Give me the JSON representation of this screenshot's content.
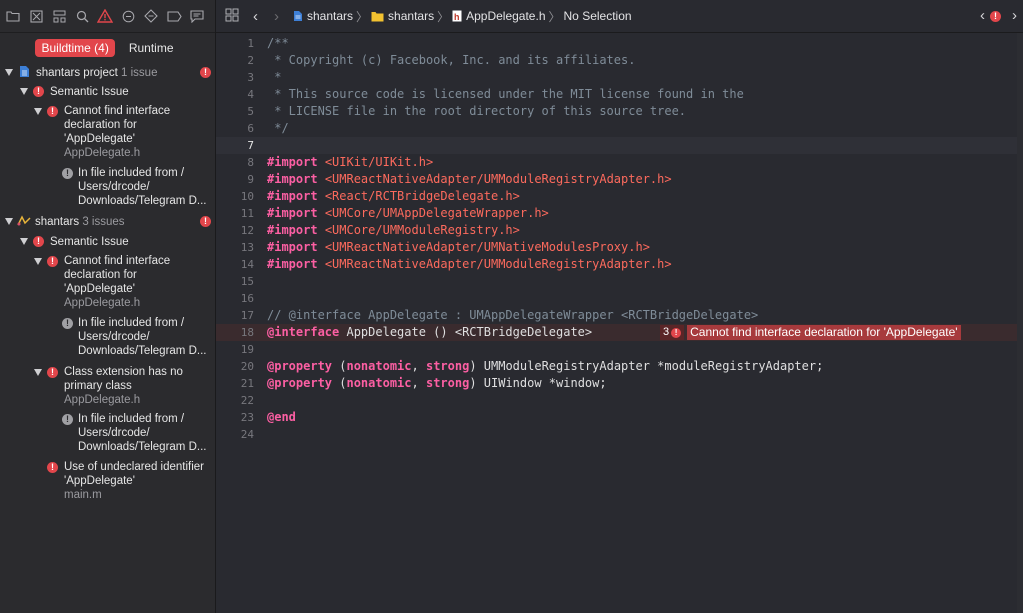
{
  "tabs": {
    "buildtime": "Buildtime (4)",
    "runtime": "Runtime"
  },
  "tree": [
    {
      "kind": "project",
      "label": "shantars project",
      "count": "1 issue"
    },
    {
      "kind": "category",
      "label": "Semantic Issue"
    },
    {
      "kind": "error",
      "lines": [
        "Cannot find interface",
        "declaration for",
        "'AppDelegate'"
      ],
      "file": "AppDelegate.h"
    },
    {
      "kind": "info",
      "lines": [
        "In file included from /",
        "Users/drcode/",
        "Downloads/Telegram D..."
      ]
    },
    {
      "kind": "target",
      "label": "shantars",
      "count": "3 issues"
    },
    {
      "kind": "category",
      "label": "Semantic Issue"
    },
    {
      "kind": "error",
      "lines": [
        "Cannot find interface",
        "declaration for",
        "'AppDelegate'"
      ],
      "file": "AppDelegate.h"
    },
    {
      "kind": "info",
      "lines": [
        "In file included from /",
        "Users/drcode/",
        "Downloads/Telegram D..."
      ]
    },
    {
      "kind": "error",
      "lines": [
        "Class extension has no",
        "primary class"
      ],
      "file": "AppDelegate.h"
    },
    {
      "kind": "info",
      "lines": [
        "In file included from /",
        "Users/drcode/",
        "Downloads/Telegram D..."
      ]
    },
    {
      "kind": "error",
      "lines": [
        "Use of undeclared identifier",
        "'AppDelegate'"
      ],
      "file": "main.m"
    }
  ],
  "jumpbar": {
    "project": "shantars",
    "folder": "shantars",
    "file": "AppDelegate.h",
    "symbol": "No Selection"
  },
  "code": {
    "lines": [
      {
        "n": "1",
        "tokens": [
          [
            "comment",
            "/**"
          ]
        ]
      },
      {
        "n": "2",
        "tokens": [
          [
            "comment",
            " * Copyright (c) Facebook, Inc. and its affiliates."
          ]
        ]
      },
      {
        "n": "3",
        "tokens": [
          [
            "comment",
            " *"
          ]
        ]
      },
      {
        "n": "4",
        "tokens": [
          [
            "comment",
            " * This source code is licensed under the MIT license found in the"
          ]
        ]
      },
      {
        "n": "5",
        "tokens": [
          [
            "comment",
            " * LICENSE file in the root directory of this source tree."
          ]
        ]
      },
      {
        "n": "6",
        "tokens": [
          [
            "comment",
            " */"
          ]
        ]
      },
      {
        "n": "7",
        "tokens": []
      },
      {
        "n": "8",
        "tokens": [
          [
            "kw",
            "#import"
          ],
          [
            "plain",
            " "
          ],
          [
            "str",
            "<UIKit/UIKit.h>"
          ]
        ]
      },
      {
        "n": "9",
        "tokens": [
          [
            "kw",
            "#import"
          ],
          [
            "plain",
            " "
          ],
          [
            "str",
            "<UMReactNativeAdapter/UMModuleRegistryAdapter.h>"
          ]
        ]
      },
      {
        "n": "10",
        "tokens": [
          [
            "kw",
            "#import"
          ],
          [
            "plain",
            " "
          ],
          [
            "str",
            "<React/RCTBridgeDelegate.h>"
          ]
        ]
      },
      {
        "n": "11",
        "tokens": [
          [
            "kw",
            "#import"
          ],
          [
            "plain",
            " "
          ],
          [
            "str",
            "<UMCore/UMAppDelegateWrapper.h>"
          ]
        ]
      },
      {
        "n": "12",
        "tokens": [
          [
            "kw",
            "#import"
          ],
          [
            "plain",
            " "
          ],
          [
            "str",
            "<UMCore/UMModuleRegistry.h>"
          ]
        ]
      },
      {
        "n": "13",
        "tokens": [
          [
            "kw",
            "#import"
          ],
          [
            "plain",
            " "
          ],
          [
            "str",
            "<UMReactNativeAdapter/UMNativeModulesProxy.h>"
          ]
        ]
      },
      {
        "n": "14",
        "tokens": [
          [
            "kw",
            "#import"
          ],
          [
            "plain",
            " "
          ],
          [
            "str",
            "<UMReactNativeAdapter/UMModuleRegistryAdapter.h>"
          ]
        ]
      },
      {
        "n": "15",
        "tokens": []
      },
      {
        "n": "16",
        "tokens": []
      },
      {
        "n": "17",
        "tokens": [
          [
            "comment",
            "// @interface AppDelegate : UMAppDelegateWrapper <RCTBridgeDelegate>"
          ]
        ]
      },
      {
        "n": "18",
        "tokens": [
          [
            "kw",
            "@interface"
          ],
          [
            "plain",
            " AppDelegate () <RCTBridgeDelegate>"
          ]
        ]
      },
      {
        "n": "19",
        "tokens": []
      },
      {
        "n": "20",
        "tokens": [
          [
            "kw",
            "@property"
          ],
          [
            "plain",
            " ("
          ],
          [
            "kw",
            "nonatomic"
          ],
          [
            "plain",
            ", "
          ],
          [
            "kw",
            "strong"
          ],
          [
            "plain",
            ") UMModuleRegistryAdapter *moduleRegistryAdapter;"
          ]
        ]
      },
      {
        "n": "21",
        "tokens": [
          [
            "kw",
            "@property"
          ],
          [
            "plain",
            " ("
          ],
          [
            "kw",
            "nonatomic"
          ],
          [
            "plain",
            ", "
          ],
          [
            "kw",
            "strong"
          ],
          [
            "plain",
            ") UIWindow *window;"
          ]
        ]
      },
      {
        "n": "22",
        "tokens": []
      },
      {
        "n": "23",
        "tokens": [
          [
            "kw",
            "@end"
          ]
        ]
      },
      {
        "n": "24",
        "tokens": []
      }
    ],
    "current_line": "7",
    "error_line": "18",
    "inline_error": {
      "count": "3",
      "message": "Cannot find interface declaration for 'AppDelegate'"
    }
  },
  "colors": {
    "error": "#e2464b",
    "keyword": "#fc5fa3",
    "string": "#fc6a5d",
    "comment": "#7f8c98"
  }
}
